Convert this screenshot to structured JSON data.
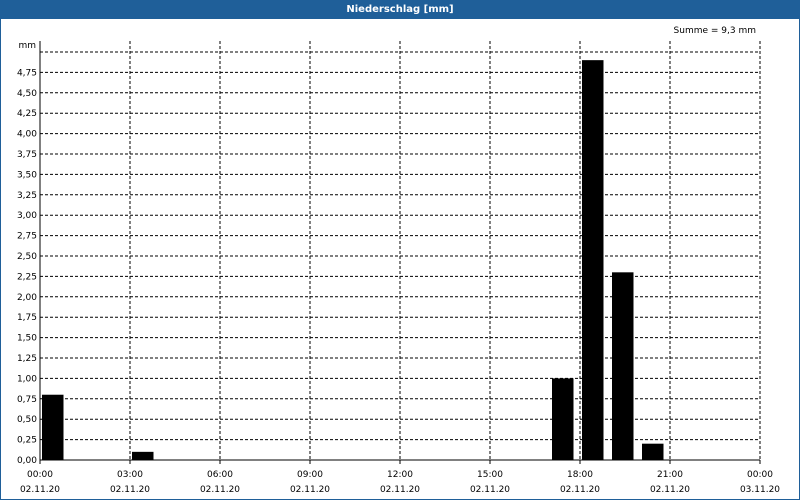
{
  "window": {
    "title": "Niederschlag [mm]"
  },
  "summary": {
    "text": "Summe = 9,3 mm"
  },
  "chart_data": {
    "type": "bar",
    "title": "Niederschlag [mm]",
    "ylabel": "mm",
    "ylim": [
      0,
      5.0
    ],
    "yticks": [
      "0,00",
      "0,25",
      "0,50",
      "0,75",
      "1,00",
      "1,25",
      "1,50",
      "1,75",
      "2,00",
      "2,25",
      "2,50",
      "2,75",
      "3,00",
      "3,25",
      "3,50",
      "3,75",
      "4,00",
      "4,25",
      "4,50",
      "4,75"
    ],
    "xticks": [
      {
        "time": "00:00",
        "date": "02.11.20"
      },
      {
        "time": "03:00",
        "date": "02.11.20"
      },
      {
        "time": "06:00",
        "date": "02.11.20"
      },
      {
        "time": "09:00",
        "date": "02.11.20"
      },
      {
        "time": "12:00",
        "date": "02.11.20"
      },
      {
        "time": "15:00",
        "date": "02.11.20"
      },
      {
        "time": "18:00",
        "date": "02.11.20"
      },
      {
        "time": "21:00",
        "date": "02.11.20"
      },
      {
        "time": "00:00",
        "date": "03.11.20"
      }
    ],
    "xlim": [
      "02.11.20 00:00",
      "03.11.20 00:00"
    ],
    "bars": [
      {
        "start": "02.11.20 00:00",
        "end": "02.11.20 00:45",
        "value": 0.8
      },
      {
        "start": "02.11.20 03:00",
        "end": "02.11.20 03:45",
        "value": 0.1
      },
      {
        "start": "02.11.20 17:00",
        "end": "02.11.20 17:45",
        "value": 1.0
      },
      {
        "start": "02.11.20 18:00",
        "end": "02.11.20 18:45",
        "value": 4.9
      },
      {
        "start": "02.11.20 19:00",
        "end": "02.11.20 19:45",
        "value": 2.3
      },
      {
        "start": "02.11.20 20:00",
        "end": "02.11.20 20:45",
        "value": 0.2
      }
    ],
    "grid": true,
    "bar_color": "#000000"
  }
}
